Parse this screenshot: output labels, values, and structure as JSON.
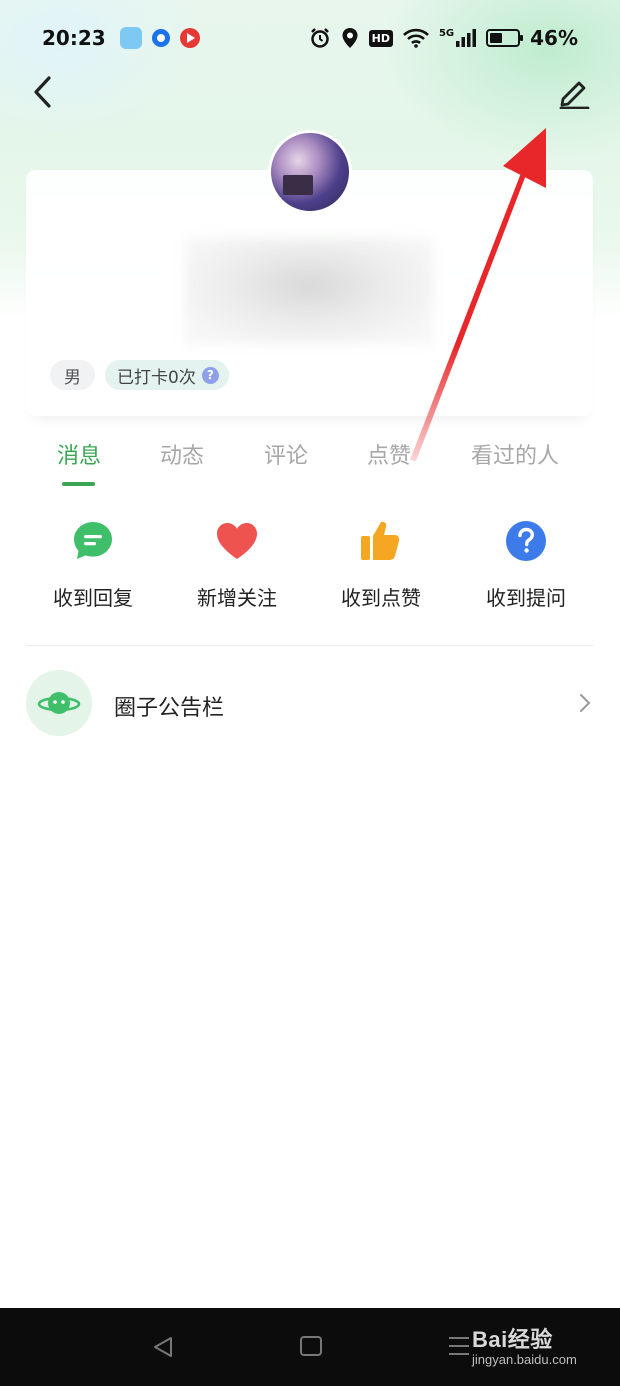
{
  "status_bar": {
    "time": "20:23",
    "network": "5G",
    "battery_percent": "46%",
    "battery_level": 0.46,
    "hd_label": "HD"
  },
  "profile": {
    "gender_tag": "男",
    "checkin_tag": "已打卡0次",
    "help_badge": "?"
  },
  "tabs": [
    {
      "label": "消息",
      "active": true
    },
    {
      "label": "动态",
      "active": false
    },
    {
      "label": "评论",
      "active": false
    },
    {
      "label": "点赞",
      "active": false
    },
    {
      "label": "看过的人",
      "active": false
    }
  ],
  "quick_actions": [
    {
      "label": "收到回复",
      "icon": "chat-bubble-icon",
      "color": "#3fbf6a"
    },
    {
      "label": "新增关注",
      "icon": "heart-icon",
      "color": "#ef5350"
    },
    {
      "label": "收到点赞",
      "icon": "thumbs-up-icon",
      "color": "#f5a623"
    },
    {
      "label": "收到提问",
      "icon": "question-icon",
      "color": "#3d7bea"
    }
  ],
  "board": {
    "label": "圈子公告栏",
    "icon": "planet-icon"
  },
  "watermark": {
    "brand": "Bai经验",
    "url": "jingyan.baidu.com"
  },
  "colors": {
    "accent_green": "#3aa653",
    "annotation_red": "#e8272a"
  }
}
